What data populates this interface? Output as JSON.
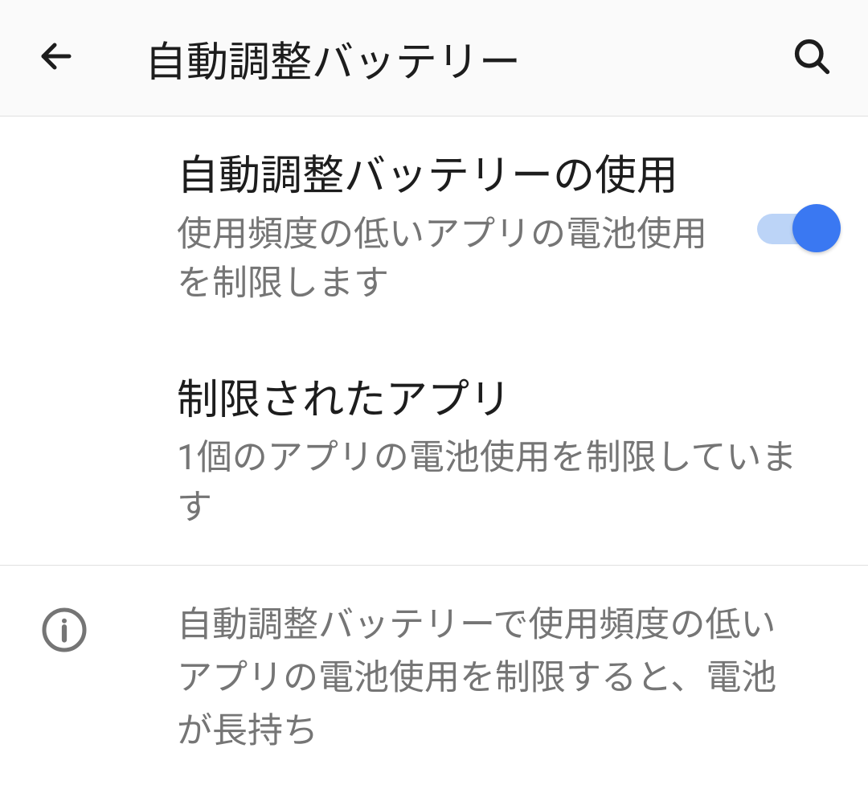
{
  "header": {
    "title": "自動調整バッテリー"
  },
  "settings": {
    "adaptive_battery": {
      "title": "自動調整バッテリーの使用",
      "subtitle": "使用頻度の低いアプリの電池使用を制限します",
      "enabled": true
    },
    "restricted_apps": {
      "title": "制限されたアプリ",
      "subtitle": "1個のアプリの電池使用を制限しています"
    }
  },
  "info": {
    "text": "自動調整バッテリーで使用頻度の低いアプリの電池使用を制限すると、電池が長持ち"
  }
}
